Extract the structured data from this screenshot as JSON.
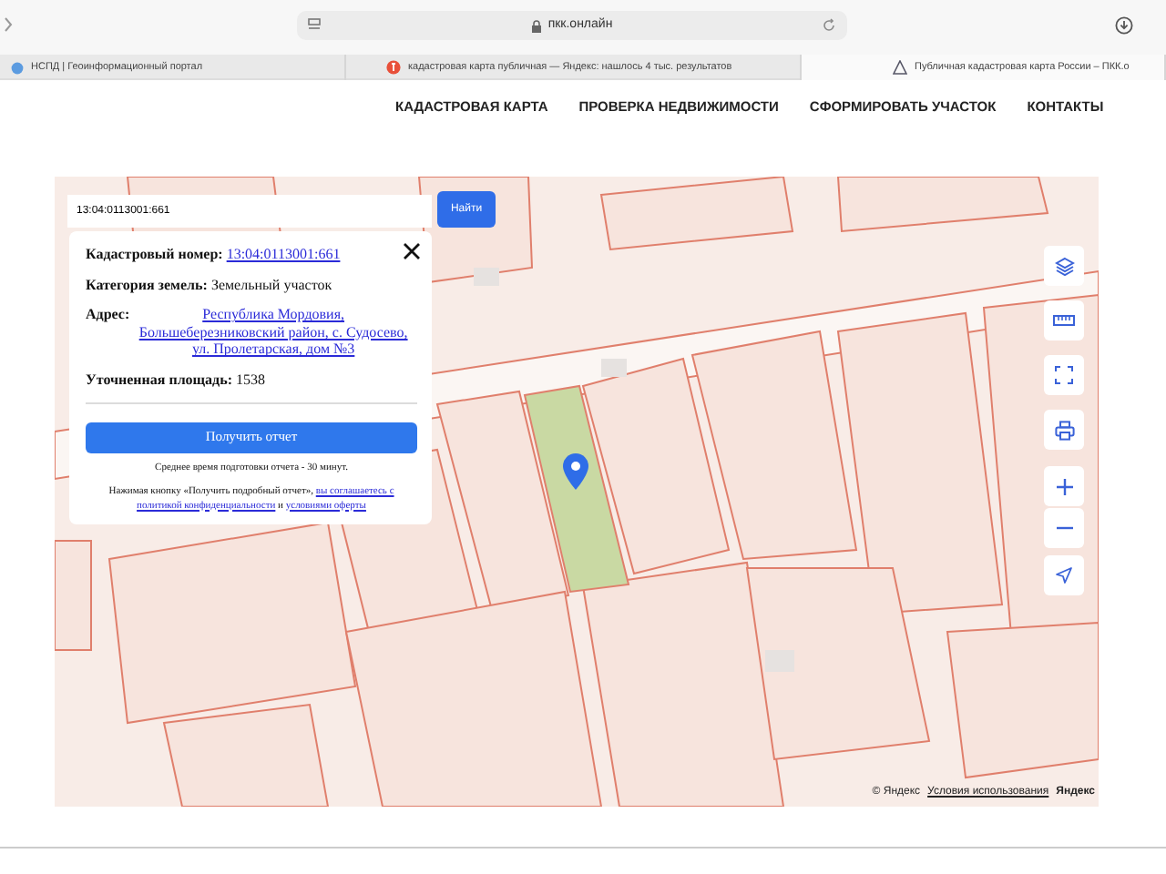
{
  "browser": {
    "address": "пкк.онлайн",
    "tabs": [
      {
        "title": "НСПД | Геоинформационный портал",
        "selected": false,
        "kind": "portal"
      },
      {
        "title": "кадастровая карта публичная — Яндекс: нашлось 4 тыс. результатов",
        "selected": false,
        "kind": "yandex"
      },
      {
        "title": "Публичная кадастровая карта России – ПКК.о",
        "selected": true,
        "kind": "site"
      }
    ]
  },
  "nav": [
    "КАДАСТРОВАЯ КАРТА",
    "ПРОВЕРКА НЕДВИЖИМОСТИ",
    "СФОРМИРОВАТЬ УЧАСТОК",
    "КОНТАКТЫ"
  ],
  "search": {
    "value": "13:04:0113001:661",
    "button": "Найти"
  },
  "info_card": {
    "fields": [
      {
        "label": "Кадастровый номер:",
        "value": "13:04:0113001:661",
        "kind": "link"
      },
      {
        "label": "Категория земель:",
        "value": "Земельный участок",
        "kind": "text"
      },
      {
        "label": "Адрес:",
        "value": "Республика Мордовия, Большеберезниковский район, с. Судосево, ул. Пролетарская, дом №3",
        "kind": "address"
      },
      {
        "label": "Уточненная площадь:",
        "value": "1538",
        "kind": "text"
      }
    ],
    "button": "Получить отчет",
    "note": "Среднее время подготовки отчета - 30 минут.",
    "consent": {
      "lead": "Нажимая кнопку «Получить подробный отчет»,",
      "policy_link": [
        "вы соглашаетесь с",
        "политикой конфиденциальности"
      ],
      "conjunction": "и",
      "offer_link": "условиями оферты"
    }
  },
  "attribution": {
    "copyright": "© Яндекс",
    "terms": "Условия использования",
    "logo": "Яндекс"
  }
}
